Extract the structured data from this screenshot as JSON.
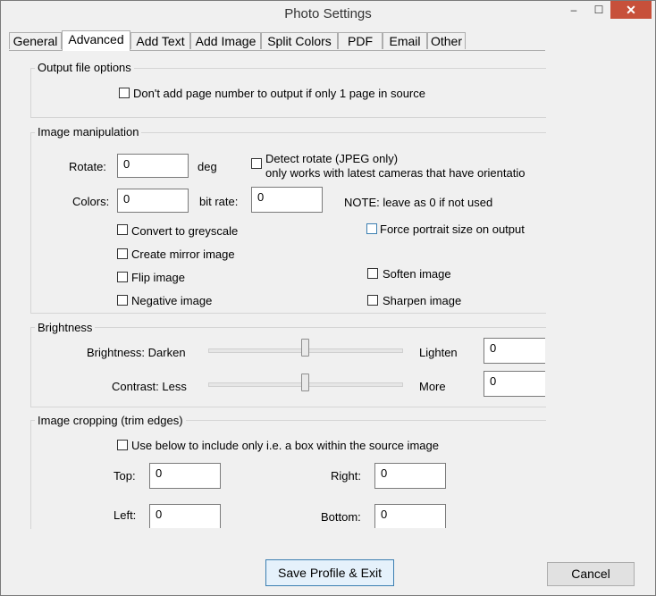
{
  "window": {
    "title": "Photo Settings",
    "minimize": "–",
    "maximize": "☐",
    "close": "✕"
  },
  "tabs": [
    "General",
    "Advanced",
    "Add Text",
    "Add Image",
    "Split Colors",
    "PDF",
    "Email",
    "Other"
  ],
  "output": {
    "group_label": "Output file options",
    "no_page_number": "Don't add page number to output if only 1 page in source"
  },
  "image": {
    "group_label": "Image manipulation",
    "rotate_label": "Rotate:",
    "rotate_value": "0",
    "deg": "deg",
    "detect_rotate": "Detect rotate  (JPEG only)",
    "detect_note": "only works with latest cameras that have orientatio",
    "colors_label": "Colors:",
    "colors_value": "0",
    "bitrate_label": "bit rate:",
    "bitrate_value": "0",
    "note": "NOTE: leave as 0 if not used",
    "greyscale": "Convert to greyscale",
    "portrait": "Force portrait size on output",
    "mirror": "Create mirror image",
    "flip": "Flip image",
    "soften": "Soften image",
    "negative": "Negative image",
    "sharpen": "Sharpen image"
  },
  "brightness": {
    "group_label": "Brightness",
    "darken": "Brightness: Darken",
    "lighten": "Lighten",
    "brightness_value": "0",
    "less": "Contrast: Less",
    "more": "More",
    "contrast_value": "0"
  },
  "crop": {
    "group_label": "Image cropping (trim edges)",
    "use_box": "Use below to include only i.e. a box within the source image",
    "top_label": "Top:",
    "top_value": "0",
    "right_label": "Right:",
    "right_value": "0",
    "left_label": "Left:",
    "left_value": "0",
    "bottom_label": "Bottom:",
    "bottom_value": "0"
  },
  "buttons": {
    "save": "Save Profile & Exit",
    "cancel": "Cancel"
  }
}
